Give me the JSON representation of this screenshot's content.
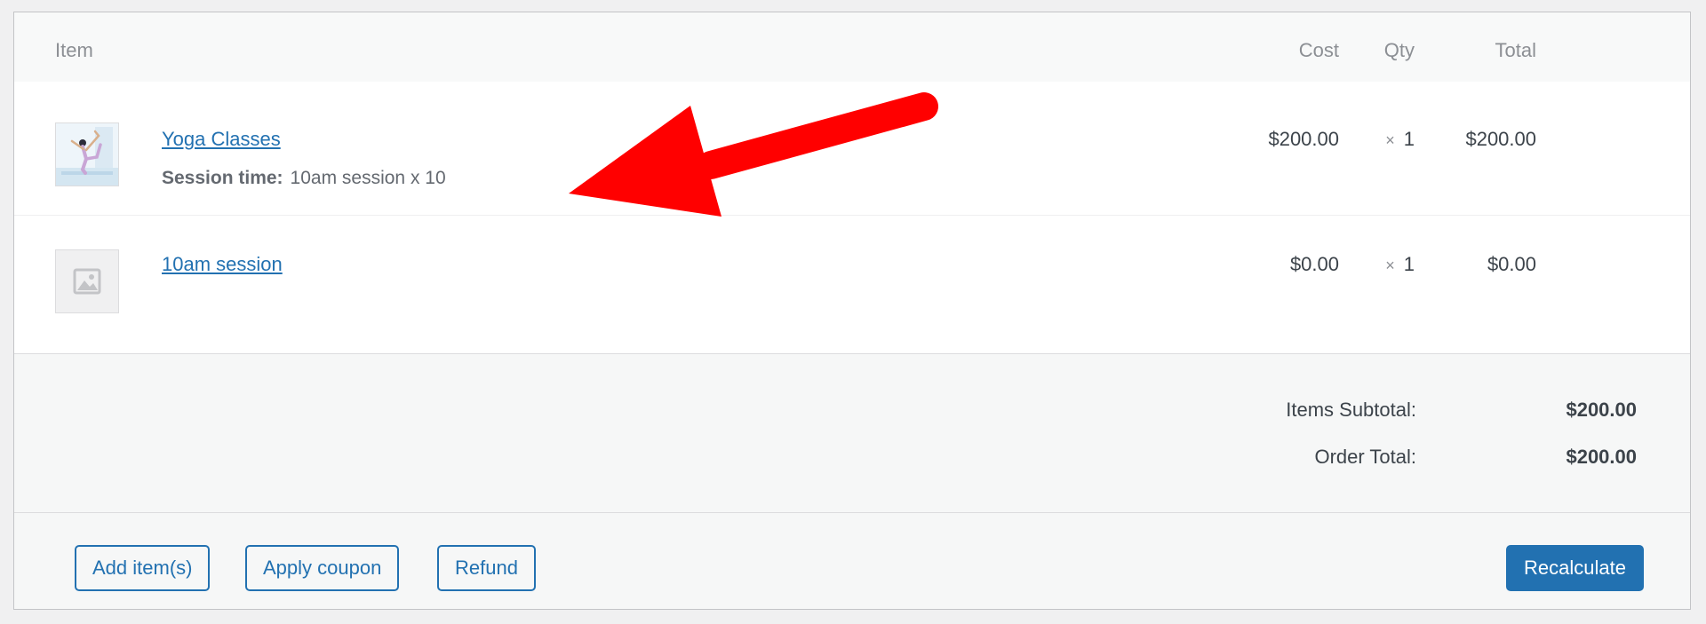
{
  "columns": {
    "item": "Item",
    "cost": "Cost",
    "qty": "Qty",
    "total": "Total"
  },
  "items": [
    {
      "name": "Yoga Classes",
      "meta_key": "Session time:",
      "meta_value": "10am session x 10",
      "cost": "$200.00",
      "qty_prefix": "×",
      "qty": "1",
      "total": "$200.00",
      "thumbnail": "yoga-pose-image"
    },
    {
      "name": "10am session",
      "cost": "$0.00",
      "qty_prefix": "×",
      "qty": "1",
      "total": "$0.00",
      "thumbnail": "placeholder-image-icon"
    }
  ],
  "totals": {
    "subtotal_label": "Items Subtotal:",
    "subtotal_value": "$200.00",
    "order_total_label": "Order Total:",
    "order_total_value": "$200.00"
  },
  "actions": {
    "add_items": "Add item(s)",
    "apply_coupon": "Apply coupon",
    "refund": "Refund",
    "recalculate": "Recalculate"
  },
  "colors": {
    "link": "#2271b1",
    "annotation_arrow": "#ff0000"
  }
}
